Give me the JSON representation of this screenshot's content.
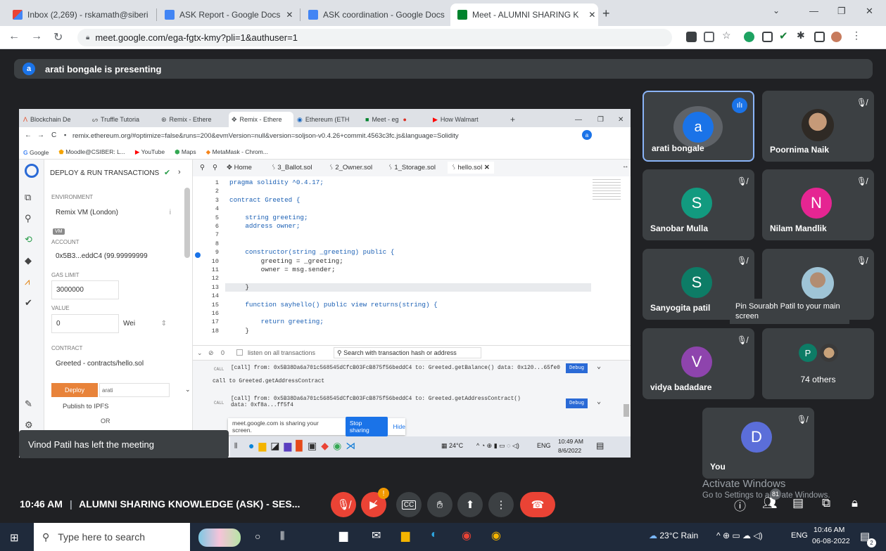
{
  "browser": {
    "tabs": [
      {
        "label": "Inbox (2,269) - rskamath@siberi",
        "icon": "gmail-icon",
        "color": "#ea4335"
      },
      {
        "label": "ASK Report - Google Docs",
        "icon": "docs-icon",
        "color": "#4285f4"
      },
      {
        "label": "ASK coordination - Google Docs",
        "icon": "docs-icon",
        "color": "#4285f4"
      },
      {
        "label": "Meet - ALUMNI SHARING K",
        "icon": "meet-icon",
        "color": "#00832d"
      }
    ],
    "new_tab": "+",
    "url": "meet.google.com/ega-fgtx-kmy?pli=1&authuser=1",
    "minimize": "—",
    "restore": "❐",
    "close": "✕"
  },
  "meet": {
    "presenting_avatar": "a",
    "presenting_text": "arati bongale is presenting",
    "notification": "Vinod Patil has left the meeting",
    "time": "10:46 AM",
    "separator": "|",
    "meeting_title": "ALUMNI SHARING KNOWLEDGE (ASK) - SES...",
    "participants": [
      {
        "name": "arati bongale",
        "initial": "a",
        "color": "#1a73e8",
        "speaking": true
      },
      {
        "name": "Poornima Naik",
        "initial": "",
        "color": "#6b5847",
        "photo": true
      },
      {
        "name": "Sanobar Mulla",
        "initial": "S",
        "color": "#129a7f"
      },
      {
        "name": "Nilam Mandlik",
        "initial": "N",
        "color": "#e52592"
      },
      {
        "name": "Sanyogita patil",
        "initial": "S",
        "color": "#0d7c66"
      },
      {
        "name": "Pin Sourabh Patil to your main screen",
        "initial": "",
        "color": "#8ab4c8",
        "photo": true
      },
      {
        "name": "vidya badadare",
        "initial": "V",
        "color": "#8e44ad"
      },
      {
        "name": "74 others",
        "initial": "P",
        "color": "#0d7c66"
      }
    ],
    "self": {
      "name": "You",
      "initial": "D",
      "color": "#5b6ed9"
    },
    "people_count": "81",
    "windows_watermark_1": "Activate Windows",
    "windows_watermark_2": "Go to Settings to activate Windows."
  },
  "shared": {
    "inner_tabs": [
      "Blockchain De",
      "Truffle Tutoria",
      "Remix - Ethere",
      "Remix - Ethere",
      "Ethereum (ETH",
      "Meet - eg",
      "How Walmart"
    ],
    "inner_url": "remix.ethereum.org/#optimize=false&runs=200&evmVersion=null&version=soljson-v0.4.26+commit.4563c3fc.js&language=Solidity",
    "bookmarks": [
      "Google",
      "Moodle@CSIBER: L...",
      "YouTube",
      "Maps",
      "MetaMask - Chrom..."
    ],
    "panel_title": "DEPLOY & RUN TRANSACTIONS",
    "environment_label": "ENVIRONMENT",
    "environment_value": "Remix VM (London)",
    "vm_badge": "VM",
    "account_label": "ACCOUNT",
    "account_value": "0x5B3...eddC4 (99.99999999",
    "gas_label": "GAS LIMIT",
    "gas_value": "3000000",
    "value_label": "VALUE",
    "value_value": "0",
    "value_unit": "Wei",
    "contract_label": "CONTRACT",
    "contract_value": "Greeted - contracts/hello.sol",
    "deploy_label": "Deploy",
    "deploy_arg": "arati",
    "publish_label": "Publish to IPFS",
    "or_label": "OR",
    "editor_tabs": [
      "Home",
      "3_Ballot.sol",
      "2_Owner.sol",
      "1_Storage.sol",
      "hello.sol"
    ],
    "line_numbers": [
      "1",
      "2",
      "3",
      "4",
      "5",
      "6",
      "7",
      "8",
      "9",
      "10",
      "11",
      "12",
      "13",
      "14",
      "15",
      "16",
      "17",
      "18"
    ],
    "code_lines": [
      "pragma solidity ^0.4.17;",
      "",
      "contract Greeted {",
      "",
      "    string greeting;",
      "    address owner;",
      "",
      "",
      "    constructor(string _greeting) public {",
      "        greeting = _greeting;",
      "        owner = msg.sender;",
      "",
      "    }",
      "",
      "    function sayhello() public view returns(string) {",
      "",
      "        return greeting;",
      "    }"
    ],
    "terminal_count": "0",
    "listen_label": "listen on all transactions",
    "search_placeholder": "Search with transaction hash or address",
    "log1_tag": "CALL",
    "log1": "[call] from: 0x5B38Da6a701c568545dCfcB03FcB875f56beddC4 to: Greeted.getBalance() data: 0x120...65fe0",
    "log1_sub": "call to Greeted.getAddressContract",
    "log2_tag": "CALL",
    "log2": "[call] from: 0x5B38Da6a701c568545dCfcB03FcB875f56beddC4 to: Greeted.getAddressContract()",
    "log2_data": "data: 0xf8a...ff5f4",
    "debug_label": "Debug",
    "sharing_text": "meet.google.com is sharing your screen.",
    "stop_sharing": "Stop sharing",
    "hide": "Hide",
    "inner_weather": "24°C",
    "inner_lang": "ENG",
    "inner_time": "10:49 AM",
    "inner_date": "8/6/2022"
  },
  "taskbar": {
    "search_placeholder": "Type here to search",
    "weather": "23°C Rain",
    "lang": "ENG",
    "time": "10:46 AM",
    "date": "06-08-2022",
    "notif_count": "2"
  }
}
